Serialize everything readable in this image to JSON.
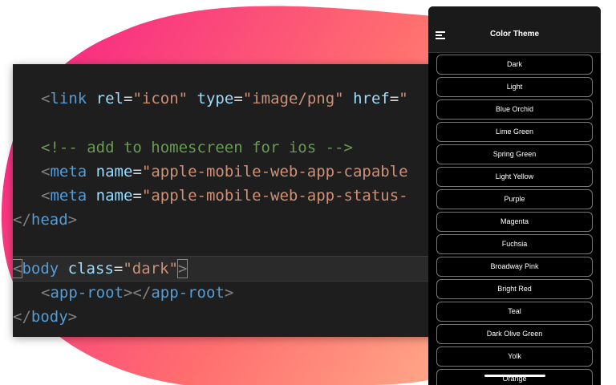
{
  "colors": {
    "background": "#ffffff",
    "blob_gradient": [
      "#f72585",
      "#ff7a6b",
      "#ffb18a"
    ],
    "editor_bg": "#1e1e1e",
    "phone_bg": "#000000"
  },
  "editor": {
    "line1": {
      "tag_open": "<",
      "tag": "link",
      "attr1": "rel",
      "val1": "\"icon\"",
      "attr2": "type",
      "val2": "\"image/png\"",
      "attr3": "href",
      "eq": "=",
      "val3": "\""
    },
    "line2": {
      "comment": "<!-- add to homescreen for ios -->"
    },
    "line3": {
      "tag_open": "<",
      "tag": "meta",
      "attr": "name",
      "eq": "=",
      "val": "\"apple-mobile-web-app-capable"
    },
    "line4": {
      "tag_open": "<",
      "tag": "meta",
      "attr": "name",
      "eq": "=",
      "val": "\"apple-mobile-web-app-status-"
    },
    "line5": {
      "open": "</",
      "tag": "head",
      "close": ">"
    },
    "line6": {
      "open": "<",
      "tag": "body",
      "attr": "class",
      "eq": "=",
      "val": "\"dark\"",
      "close": ">"
    },
    "line7": {
      "open1": "<",
      "tag1": "app-root",
      "close1": ">",
      "open2": "</",
      "tag2": "app-root",
      "close2": ">"
    },
    "line8": {
      "open": "</",
      "tag": "body",
      "close": ">"
    }
  },
  "phone": {
    "menu_icon": "hamburger-menu-icon",
    "title": "Color Theme",
    "themes": [
      "Dark",
      "Light",
      "Blue Orchid",
      "Lime Green",
      "Spring Green",
      "Light Yellow",
      "Purple",
      "Magenta",
      "Fuchsia",
      "Broadway Pink",
      "Bright Red",
      "Teal",
      "Dark Olive Green",
      "Yolk",
      "Orange"
    ]
  }
}
